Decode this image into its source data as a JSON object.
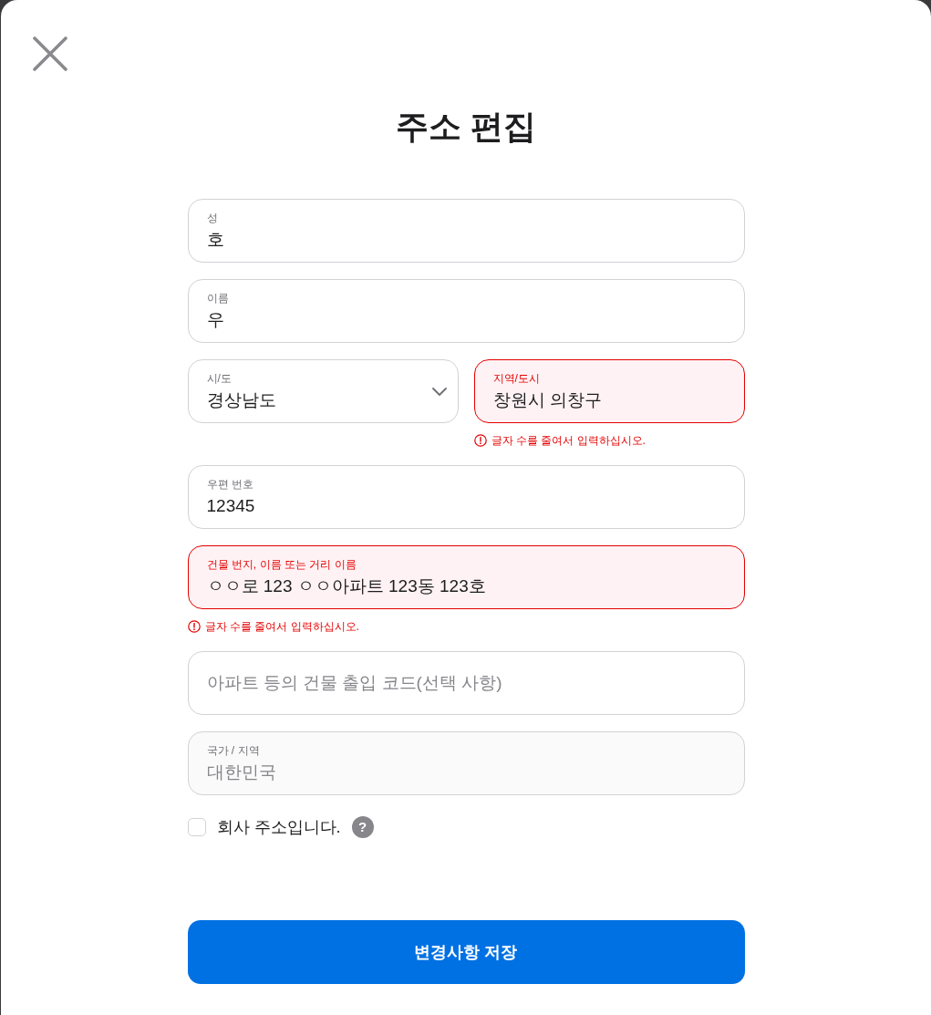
{
  "dialog": {
    "title": "주소 편집"
  },
  "rows": [
    {
      "fields": [
        {
          "kind": "text",
          "label": "성",
          "value": "호",
          "invalid": false,
          "disabled": false
        }
      ]
    },
    {
      "fields": [
        {
          "kind": "text",
          "label": "이름",
          "value": "우",
          "invalid": false,
          "disabled": false
        }
      ]
    },
    {
      "fields": [
        {
          "kind": "select",
          "label": "시/도",
          "value": "경상남도",
          "invalid": false,
          "disabled": false
        },
        {
          "kind": "text",
          "label": "지역/도시",
          "value": "창원시 의창구",
          "invalid": true,
          "disabled": false,
          "error": "글자 수를 줄여서 입력하십시오."
        }
      ]
    },
    {
      "fields": [
        {
          "kind": "text",
          "label": "우편 번호",
          "value": "12345",
          "invalid": false,
          "disabled": false
        }
      ]
    },
    {
      "fields": [
        {
          "kind": "text",
          "label": "건물 번지, 이름 또는 거리 이름",
          "value": "ㅇㅇ로 123 ㅇㅇ아파트 123동 123호",
          "invalid": true,
          "disabled": false,
          "error": "글자 수를 줄여서 입력하십시오."
        }
      ]
    },
    {
      "fields": [
        {
          "kind": "text",
          "placeholder": "아파트 등의 건물 출입 코드(선택 사항)",
          "invalid": false,
          "disabled": false
        }
      ]
    },
    {
      "fields": [
        {
          "kind": "text",
          "label": "국가 / 지역",
          "value": "대한민국",
          "invalid": false,
          "disabled": true
        }
      ]
    }
  ],
  "checkbox": {
    "label": "회사 주소입니다.",
    "checked": false,
    "help": "?"
  },
  "save_button": {
    "label": "변경사항 저장"
  }
}
